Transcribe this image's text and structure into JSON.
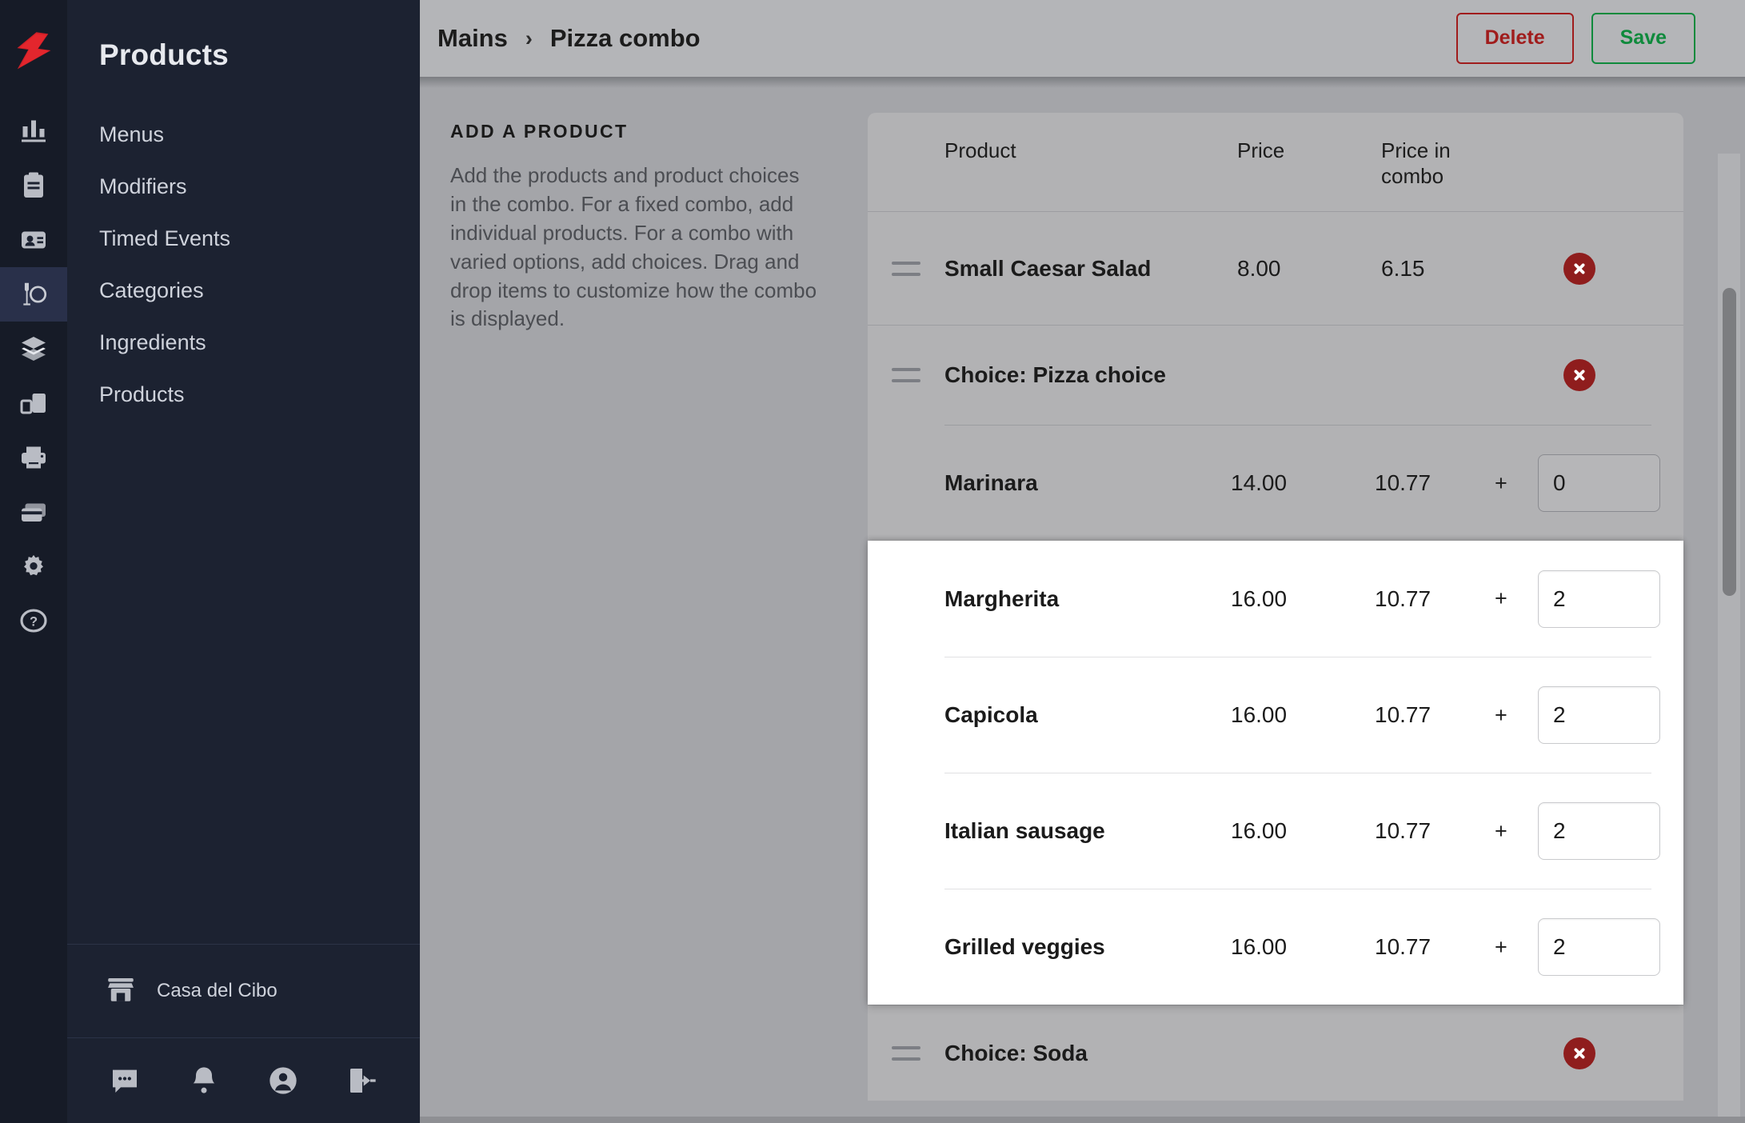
{
  "brand": {
    "logo_name": "lightspeed-logo"
  },
  "rail": {
    "items": [
      {
        "name": "reports-icon",
        "label": "Reports",
        "active": false
      },
      {
        "name": "clipboard-icon",
        "label": "Orders",
        "active": false
      },
      {
        "name": "contacts-icon",
        "label": "Customers",
        "active": false
      },
      {
        "name": "restaurant-icon",
        "label": "Products",
        "active": true
      },
      {
        "name": "layers-icon",
        "label": "Inventory",
        "active": false
      },
      {
        "name": "devices-icon",
        "label": "Devices",
        "active": false
      },
      {
        "name": "printer-icon",
        "label": "Printers",
        "active": false
      },
      {
        "name": "payments-icon",
        "label": "Payments",
        "active": false
      },
      {
        "name": "gear-icon",
        "label": "Settings",
        "active": false
      },
      {
        "name": "help-icon",
        "label": "Help",
        "active": false
      }
    ]
  },
  "sidebar": {
    "title": "Products",
    "items": [
      {
        "label": "Menus"
      },
      {
        "label": "Modifiers"
      },
      {
        "label": "Timed Events"
      },
      {
        "label": "Categories"
      },
      {
        "label": "Ingredients"
      },
      {
        "label": "Products"
      }
    ],
    "store": {
      "icon": "store-icon",
      "name": "Casa del Cibo"
    },
    "footer_icons": [
      {
        "name": "chat-icon",
        "label": "Messages"
      },
      {
        "name": "bell-icon",
        "label": "Notifications"
      },
      {
        "name": "account-icon",
        "label": "Account"
      },
      {
        "name": "logout-icon",
        "label": "Log out"
      }
    ]
  },
  "topbar": {
    "breadcrumb": {
      "parent": "Mains",
      "separator": "›",
      "current": "Pizza combo"
    },
    "delete_label": "Delete",
    "save_label": "Save",
    "delete_color": "#a01c1c",
    "save_color": "#0f8a3c"
  },
  "left_pane": {
    "eyebrow": "ADD A PRODUCT",
    "description": "Add the products and product choices in the combo. For a fixed combo, add individual products. For a combo with varied options, add choices. Drag and drop items to customize how the combo is displayed."
  },
  "table": {
    "headers": {
      "product": "Product",
      "price": "Price",
      "price_in_combo": "Price in combo"
    },
    "product_row": {
      "name": "Small Caesar Salad",
      "price": "8.00",
      "price_in_combo": "6.15",
      "handle": "drag-handle-icon",
      "delete": "delete-icon"
    },
    "choice_pizza": {
      "title": "Choice: Pizza choice",
      "handle": "drag-handle-icon",
      "delete": "delete-icon",
      "options": [
        {
          "name": "Marinara",
          "price": "14.00",
          "price_in_combo": "10.77",
          "plus": "+",
          "qty": "0",
          "highlighted": false
        },
        {
          "name": "Margherita",
          "price": "16.00",
          "price_in_combo": "10.77",
          "plus": "+",
          "qty": "2",
          "highlighted": true
        },
        {
          "name": "Capicola",
          "price": "16.00",
          "price_in_combo": "10.77",
          "plus": "+",
          "qty": "2",
          "highlighted": true
        },
        {
          "name": "Italian sausage",
          "price": "16.00",
          "price_in_combo": "10.77",
          "plus": "+",
          "qty": "2",
          "highlighted": true
        },
        {
          "name": "Grilled veggies",
          "price": "16.00",
          "price_in_combo": "10.77",
          "plus": "+",
          "qty": "2",
          "highlighted": true
        }
      ]
    },
    "choice_soda": {
      "title": "Choice: Soda",
      "handle": "drag-handle-icon",
      "delete": "delete-icon"
    }
  },
  "scrollbars": {
    "vertical_name": "vertical-scrollbar",
    "horizontal_name": "horizontal-scrollbar"
  }
}
